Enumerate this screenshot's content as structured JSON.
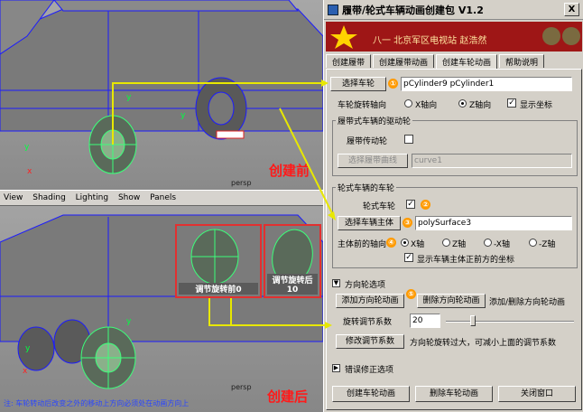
{
  "viewport_top": {
    "camera": "persp"
  },
  "viewport_bottom": {
    "camera": "persp"
  },
  "menubar": [
    "View",
    "Shading",
    "Lighting",
    "Show",
    "Panels"
  ],
  "annotations": {
    "before": "创建前",
    "after": "创建后"
  },
  "insets": [
    {
      "label": "调节旋转前0"
    },
    {
      "label": "调节旋转后10"
    }
  ],
  "status_text": "注: 车轮转动后改变之外的移动上方向必须处在动画方向上",
  "window": {
    "title": "履带/轮式车辆动画创建包 V1.2",
    "close": "X",
    "banner": "八一  北京军区电视站  赵浩然",
    "tabs": [
      "创建履带",
      "创建履带动画",
      "创建车轮动画",
      "帮助说明"
    ],
    "active_tab": 2,
    "select_wheel": {
      "button": "选择车轮",
      "marker": "①",
      "value": "pCylinder9 pCylinder1"
    },
    "axis_row": {
      "label": "车轮旋转轴向",
      "options": [
        "X轴向",
        "Z轴向"
      ],
      "selected": 1,
      "show_axis_label": "显示坐标",
      "show_axis": true
    },
    "track_group": {
      "title": "履带式车辆的驱动轮",
      "track_wheel_label": "履带传动轮",
      "track_wheel_checked": false,
      "curve_button": "选择履带曲线",
      "curve_value": "curve1"
    },
    "wheeled_group": {
      "title": "轮式车辆的车轮",
      "wheeled_label": "轮式车轮",
      "wheeled_checked": true,
      "marker2": "②",
      "body_button": "选择车辆主体",
      "marker3": "③",
      "body_value": "polySurface3",
      "forward_label": "主体前的轴向",
      "marker4": "④",
      "forward_options": [
        "X轴",
        "Z轴",
        "-X轴",
        "-Z轴"
      ],
      "forward_selected": 0,
      "show_front_label": "显示车辆主体正前方的坐标",
      "show_front": true
    },
    "direction_section": {
      "title": "方向轮选项",
      "add_button": "添加方向轮动画",
      "marker5": "⑤",
      "remove_button": "删除方向轮动画",
      "add_remove_label": "添加/删除方向轮动画",
      "ratio_label": "旋转调节系数",
      "ratio_value": "20",
      "ratio_slider": 0.2,
      "modify_button": "修改调节系数",
      "modify_hint": "方向轮旋转过大，可减小上面的调节系数"
    },
    "error_section": {
      "title": "错误修正选项"
    },
    "bottom_buttons": [
      "创建车轮动画",
      "删除车轮动画",
      "关闭窗口"
    ]
  },
  "colors": {
    "annotation": "#ff1a1a",
    "wire_green": "#3cff7a",
    "banner_red": "#9e1616",
    "marker": "#ff9a00",
    "arrow": "#e8e800"
  }
}
